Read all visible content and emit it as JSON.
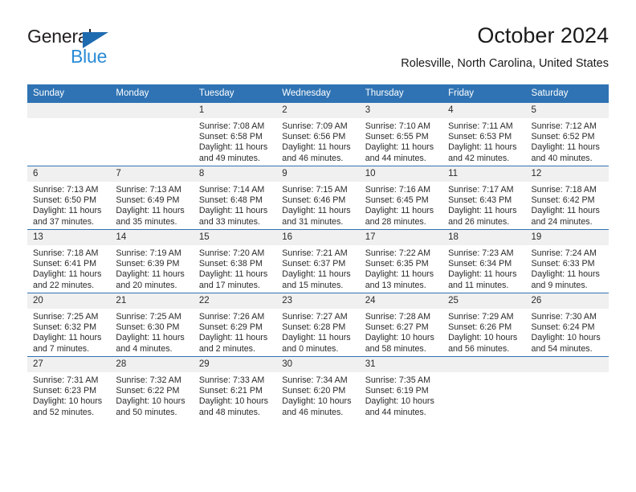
{
  "brand": {
    "name_top": "General",
    "name_bottom": "Blue",
    "triangle_color": "#1f6bb0",
    "blue_text_color": "#2b8bd6"
  },
  "header": {
    "title": "October 2024",
    "subtitle": "Rolesville, North Carolina, United States"
  },
  "theme": {
    "header_blue": "#2f73b4",
    "daynum_gray": "#f0f0f0",
    "text": "#2a2a2a"
  },
  "calendar": {
    "weekday_headers": [
      "Sunday",
      "Monday",
      "Tuesday",
      "Wednesday",
      "Thursday",
      "Friday",
      "Saturday"
    ],
    "weeks": [
      [
        {
          "day": "",
          "sunrise": "",
          "sunset": "",
          "daylight_line1": "",
          "daylight_line2": ""
        },
        {
          "day": "",
          "sunrise": "",
          "sunset": "",
          "daylight_line1": "",
          "daylight_line2": ""
        },
        {
          "day": "1",
          "sunrise": "Sunrise: 7:08 AM",
          "sunset": "Sunset: 6:58 PM",
          "daylight_line1": "Daylight: 11 hours",
          "daylight_line2": "and 49 minutes."
        },
        {
          "day": "2",
          "sunrise": "Sunrise: 7:09 AM",
          "sunset": "Sunset: 6:56 PM",
          "daylight_line1": "Daylight: 11 hours",
          "daylight_line2": "and 46 minutes."
        },
        {
          "day": "3",
          "sunrise": "Sunrise: 7:10 AM",
          "sunset": "Sunset: 6:55 PM",
          "daylight_line1": "Daylight: 11 hours",
          "daylight_line2": "and 44 minutes."
        },
        {
          "day": "4",
          "sunrise": "Sunrise: 7:11 AM",
          "sunset": "Sunset: 6:53 PM",
          "daylight_line1": "Daylight: 11 hours",
          "daylight_line2": "and 42 minutes."
        },
        {
          "day": "5",
          "sunrise": "Sunrise: 7:12 AM",
          "sunset": "Sunset: 6:52 PM",
          "daylight_line1": "Daylight: 11 hours",
          "daylight_line2": "and 40 minutes."
        }
      ],
      [
        {
          "day": "6",
          "sunrise": "Sunrise: 7:13 AM",
          "sunset": "Sunset: 6:50 PM",
          "daylight_line1": "Daylight: 11 hours",
          "daylight_line2": "and 37 minutes."
        },
        {
          "day": "7",
          "sunrise": "Sunrise: 7:13 AM",
          "sunset": "Sunset: 6:49 PM",
          "daylight_line1": "Daylight: 11 hours",
          "daylight_line2": "and 35 minutes."
        },
        {
          "day": "8",
          "sunrise": "Sunrise: 7:14 AM",
          "sunset": "Sunset: 6:48 PM",
          "daylight_line1": "Daylight: 11 hours",
          "daylight_line2": "and 33 minutes."
        },
        {
          "day": "9",
          "sunrise": "Sunrise: 7:15 AM",
          "sunset": "Sunset: 6:46 PM",
          "daylight_line1": "Daylight: 11 hours",
          "daylight_line2": "and 31 minutes."
        },
        {
          "day": "10",
          "sunrise": "Sunrise: 7:16 AM",
          "sunset": "Sunset: 6:45 PM",
          "daylight_line1": "Daylight: 11 hours",
          "daylight_line2": "and 28 minutes."
        },
        {
          "day": "11",
          "sunrise": "Sunrise: 7:17 AM",
          "sunset": "Sunset: 6:43 PM",
          "daylight_line1": "Daylight: 11 hours",
          "daylight_line2": "and 26 minutes."
        },
        {
          "day": "12",
          "sunrise": "Sunrise: 7:18 AM",
          "sunset": "Sunset: 6:42 PM",
          "daylight_line1": "Daylight: 11 hours",
          "daylight_line2": "and 24 minutes."
        }
      ],
      [
        {
          "day": "13",
          "sunrise": "Sunrise: 7:18 AM",
          "sunset": "Sunset: 6:41 PM",
          "daylight_line1": "Daylight: 11 hours",
          "daylight_line2": "and 22 minutes."
        },
        {
          "day": "14",
          "sunrise": "Sunrise: 7:19 AM",
          "sunset": "Sunset: 6:39 PM",
          "daylight_line1": "Daylight: 11 hours",
          "daylight_line2": "and 20 minutes."
        },
        {
          "day": "15",
          "sunrise": "Sunrise: 7:20 AM",
          "sunset": "Sunset: 6:38 PM",
          "daylight_line1": "Daylight: 11 hours",
          "daylight_line2": "and 17 minutes."
        },
        {
          "day": "16",
          "sunrise": "Sunrise: 7:21 AM",
          "sunset": "Sunset: 6:37 PM",
          "daylight_line1": "Daylight: 11 hours",
          "daylight_line2": "and 15 minutes."
        },
        {
          "day": "17",
          "sunrise": "Sunrise: 7:22 AM",
          "sunset": "Sunset: 6:35 PM",
          "daylight_line1": "Daylight: 11 hours",
          "daylight_line2": "and 13 minutes."
        },
        {
          "day": "18",
          "sunrise": "Sunrise: 7:23 AM",
          "sunset": "Sunset: 6:34 PM",
          "daylight_line1": "Daylight: 11 hours",
          "daylight_line2": "and 11 minutes."
        },
        {
          "day": "19",
          "sunrise": "Sunrise: 7:24 AM",
          "sunset": "Sunset: 6:33 PM",
          "daylight_line1": "Daylight: 11 hours",
          "daylight_line2": "and 9 minutes."
        }
      ],
      [
        {
          "day": "20",
          "sunrise": "Sunrise: 7:25 AM",
          "sunset": "Sunset: 6:32 PM",
          "daylight_line1": "Daylight: 11 hours",
          "daylight_line2": "and 7 minutes."
        },
        {
          "day": "21",
          "sunrise": "Sunrise: 7:25 AM",
          "sunset": "Sunset: 6:30 PM",
          "daylight_line1": "Daylight: 11 hours",
          "daylight_line2": "and 4 minutes."
        },
        {
          "day": "22",
          "sunrise": "Sunrise: 7:26 AM",
          "sunset": "Sunset: 6:29 PM",
          "daylight_line1": "Daylight: 11 hours",
          "daylight_line2": "and 2 minutes."
        },
        {
          "day": "23",
          "sunrise": "Sunrise: 7:27 AM",
          "sunset": "Sunset: 6:28 PM",
          "daylight_line1": "Daylight: 11 hours",
          "daylight_line2": "and 0 minutes."
        },
        {
          "day": "24",
          "sunrise": "Sunrise: 7:28 AM",
          "sunset": "Sunset: 6:27 PM",
          "daylight_line1": "Daylight: 10 hours",
          "daylight_line2": "and 58 minutes."
        },
        {
          "day": "25",
          "sunrise": "Sunrise: 7:29 AM",
          "sunset": "Sunset: 6:26 PM",
          "daylight_line1": "Daylight: 10 hours",
          "daylight_line2": "and 56 minutes."
        },
        {
          "day": "26",
          "sunrise": "Sunrise: 7:30 AM",
          "sunset": "Sunset: 6:24 PM",
          "daylight_line1": "Daylight: 10 hours",
          "daylight_line2": "and 54 minutes."
        }
      ],
      [
        {
          "day": "27",
          "sunrise": "Sunrise: 7:31 AM",
          "sunset": "Sunset: 6:23 PM",
          "daylight_line1": "Daylight: 10 hours",
          "daylight_line2": "and 52 minutes."
        },
        {
          "day": "28",
          "sunrise": "Sunrise: 7:32 AM",
          "sunset": "Sunset: 6:22 PM",
          "daylight_line1": "Daylight: 10 hours",
          "daylight_line2": "and 50 minutes."
        },
        {
          "day": "29",
          "sunrise": "Sunrise: 7:33 AM",
          "sunset": "Sunset: 6:21 PM",
          "daylight_line1": "Daylight: 10 hours",
          "daylight_line2": "and 48 minutes."
        },
        {
          "day": "30",
          "sunrise": "Sunrise: 7:34 AM",
          "sunset": "Sunset: 6:20 PM",
          "daylight_line1": "Daylight: 10 hours",
          "daylight_line2": "and 46 minutes."
        },
        {
          "day": "31",
          "sunrise": "Sunrise: 7:35 AM",
          "sunset": "Sunset: 6:19 PM",
          "daylight_line1": "Daylight: 10 hours",
          "daylight_line2": "and 44 minutes."
        },
        {
          "day": "",
          "sunrise": "",
          "sunset": "",
          "daylight_line1": "",
          "daylight_line2": ""
        },
        {
          "day": "",
          "sunrise": "",
          "sunset": "",
          "daylight_line1": "",
          "daylight_line2": ""
        }
      ]
    ]
  }
}
